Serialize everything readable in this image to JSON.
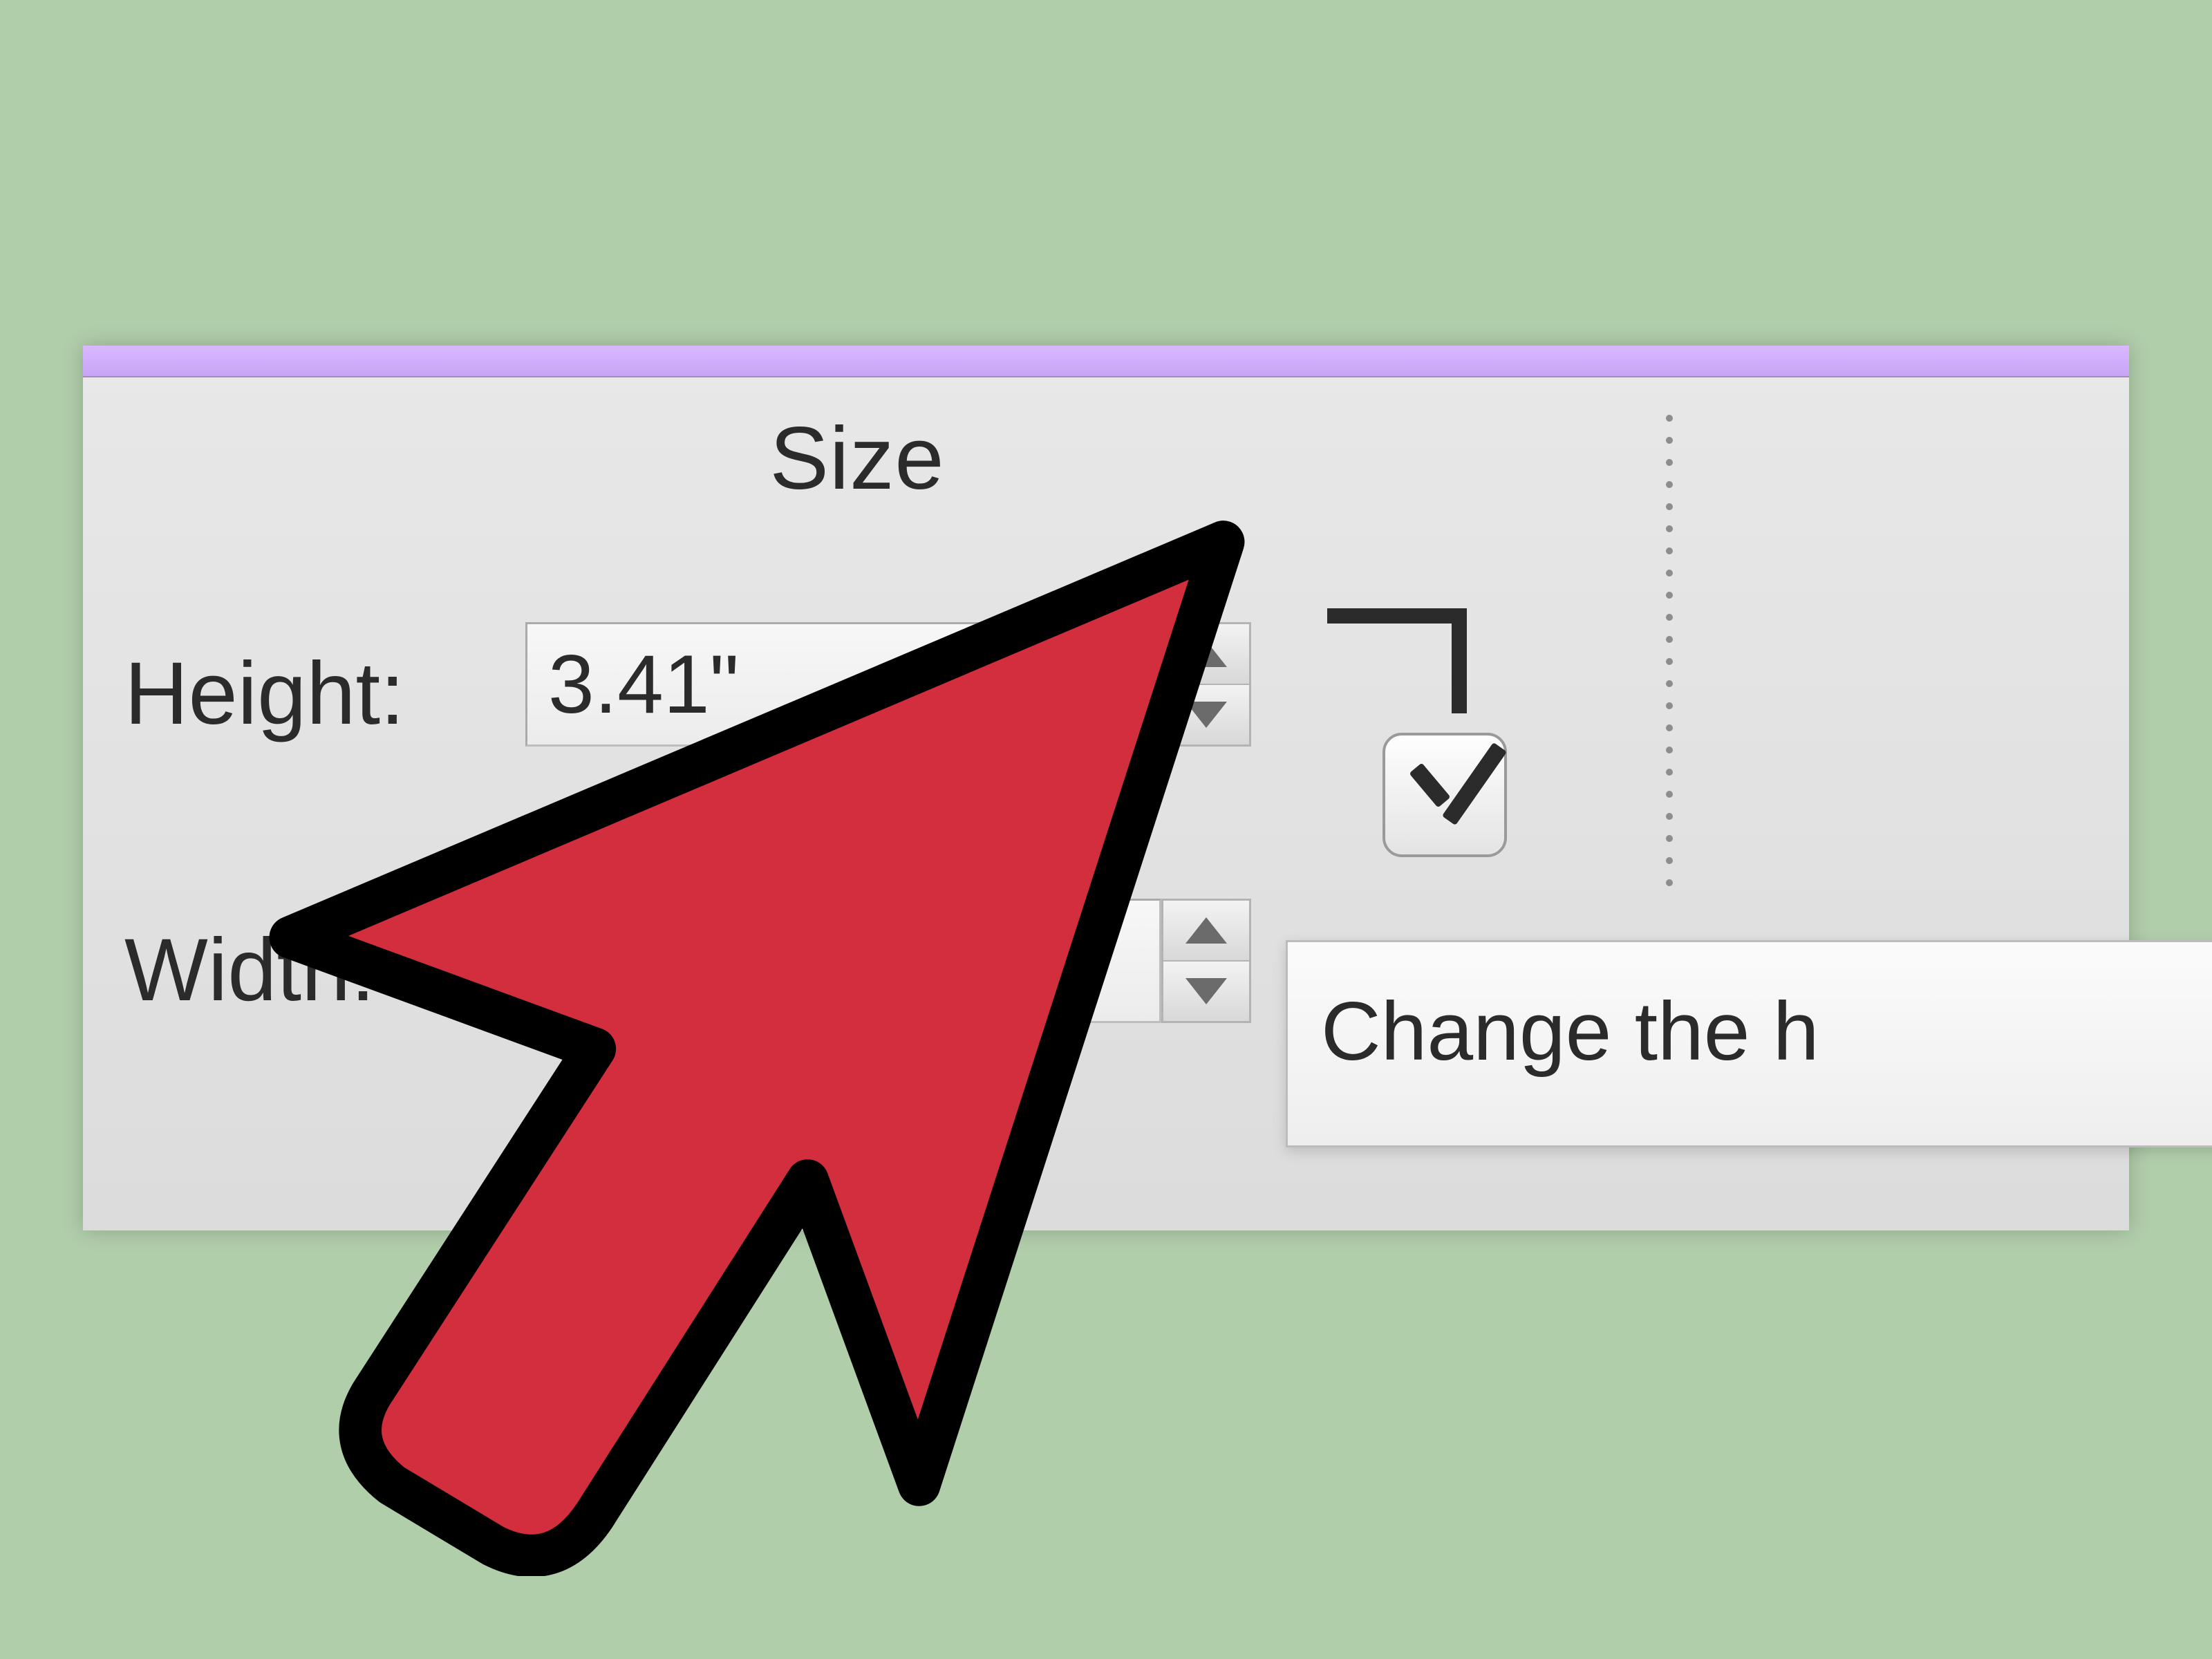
{
  "section": {
    "title": "Size"
  },
  "height": {
    "label": "Height:",
    "value": "3.41\""
  },
  "width": {
    "label": "Width:",
    "value": ""
  },
  "lock_aspect": {
    "checked": true
  },
  "tooltip": {
    "text": "Change the h"
  },
  "colors": {
    "background": "#b1ceab",
    "titlebar": "#c8a5f7",
    "arrow_fill": "#d22e3e",
    "arrow_stroke": "#000000"
  },
  "icons": {
    "increment": "triangle-up-icon",
    "decrement": "triangle-down-icon",
    "lock": "aspect-lock-icon",
    "checkmark": "checkmark-icon",
    "cursor": "cursor-arrow-icon"
  }
}
